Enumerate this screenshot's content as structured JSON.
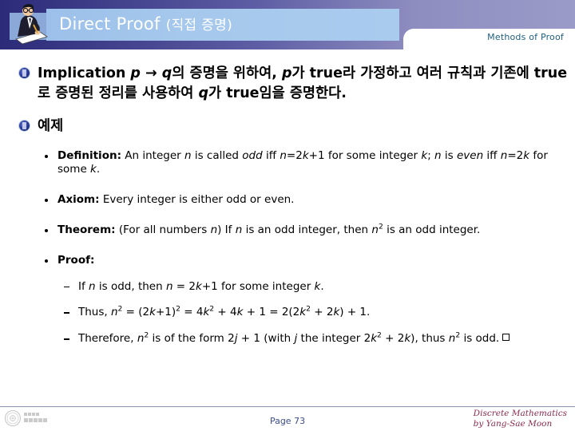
{
  "header": {
    "title_main": "Direct Proof ",
    "title_sub": "(직접 증명)",
    "section_label": "Methods of Proof",
    "presenter_icon": "person-writing-clipart",
    "bar_color": "#a6c8ec",
    "gradient_from": "#2b2b7a",
    "gradient_to": "#9b9bc9",
    "label_color": "#1f6080"
  },
  "content": {
    "bullet1": {
      "icon": "blue-gem-bullet",
      "segments": [
        {
          "text": "Implication ",
          "style": "bold"
        },
        {
          "text": "p",
          "style": "bold-italic"
        },
        {
          "text": " → ",
          "style": "bold"
        },
        {
          "text": "q",
          "style": "bold-italic"
        },
        {
          "text": "의 증명을 위하여, ",
          "style": "bold"
        },
        {
          "text": "p",
          "style": "bold-italic"
        },
        {
          "text": "가 ",
          "style": "bold"
        },
        {
          "text": "true",
          "style": "bold"
        },
        {
          "text": "라 가정하고 여러 규칙과 기존에 ",
          "style": "bold"
        },
        {
          "text": "true",
          "style": "bold"
        },
        {
          "text": "로 증명된 정리를 사용하여 ",
          "style": "bold"
        },
        {
          "text": "q",
          "style": "bold-italic"
        },
        {
          "text": "가 ",
          "style": "bold"
        },
        {
          "text": "true",
          "style": "bold"
        },
        {
          "text": "임을 증명한다.",
          "style": "bold"
        }
      ],
      "plain_text": "Implication p → q의 증명을 위하여, p가 true라 가정하고 여러 규칙과 기존에 true로 증명된 정리를 사용하여 q가 true임을 증명한다."
    },
    "bullet2": {
      "icon": "blue-gem-bullet",
      "label": "예제"
    },
    "items": [
      {
        "name": "definition",
        "label": "Definition:",
        "text": "An integer n is called odd iff n=2k+1 for some integer k; n is even iff n=2k for some k."
      },
      {
        "name": "axiom",
        "label": "Axiom:",
        "text": "Every integer is either odd or even."
      },
      {
        "name": "theorem",
        "label": "Theorem:",
        "text": "(For all numbers n) If n is an odd integer, then n2 is an odd integer."
      },
      {
        "name": "proof",
        "label": "Proof:",
        "text": ""
      }
    ],
    "proof_steps": [
      {
        "name": "proof-step-1",
        "text": "If n is odd, then n = 2k+1 for some integer k."
      },
      {
        "name": "proof-step-2",
        "text": "Thus, n2 = (2k+1)2 = 4k2 + 4k + 1 = 2(2k2 + 2k) + 1."
      },
      {
        "name": "proof-step-3",
        "text": "Therefore, n2 is of the form 2j + 1 (with j the integer 2k2 + 2k), thus n2 is odd."
      }
    ]
  },
  "footer": {
    "page": "Page 73",
    "course": "Discrete Mathematics",
    "author": "by Yang-Sae Moon",
    "logo": "university-emblem",
    "credit_color": "#8c2a4a",
    "page_color": "#3b4c8a"
  }
}
